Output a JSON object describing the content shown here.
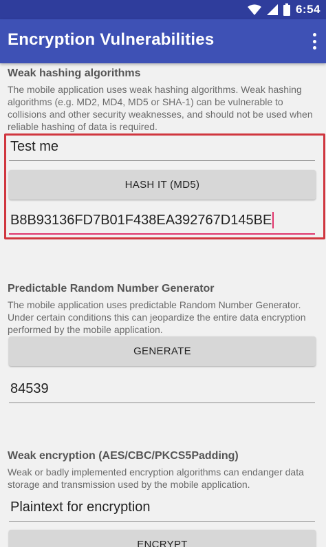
{
  "status_bar": {
    "time": "6:54",
    "icons": [
      "wifi-icon",
      "cellular-signal-icon",
      "battery-icon"
    ]
  },
  "app_bar": {
    "title": "Encryption Vulnerabilities",
    "menu_icon": "overflow-menu-icon"
  },
  "weak_hashing": {
    "title": "Weak hashing algorithms",
    "description": "The mobile application uses weak hashing algorithms. Weak hashing algorithms (e.g. MD2, MD4, MD5 or SHA-1) can be vulnerable to collisions and other security weaknesses, and should not be used when reliable hashing of data is required.",
    "input_value": "Test me",
    "button_label": "HASH IT (MD5)",
    "output_value": "B8B93136FD7B01F438EA392767D145BE"
  },
  "prng": {
    "title": "Predictable Random Number Generator",
    "description": "The mobile application uses predictable Random Number Generator. Under certain conditions this can jeopardize the entire data encryption performed by the mobile application.",
    "button_label": "GENERATE",
    "output_value": "84539"
  },
  "weak_encryption": {
    "title": "Weak encryption (AES/CBC/PKCS5Padding)",
    "description": "Weak or badly implemented encryption algorithms can endanger data storage and transmission used by the mobile application.",
    "input_value": "Plaintext for encryption",
    "button_label": "ENCRYPT"
  },
  "colors": {
    "status_bar": "#2f3d9c",
    "app_bar": "#3e51b5",
    "highlight": "#d0363f",
    "accent": "#e0336b",
    "button": "#d7d7d7"
  }
}
